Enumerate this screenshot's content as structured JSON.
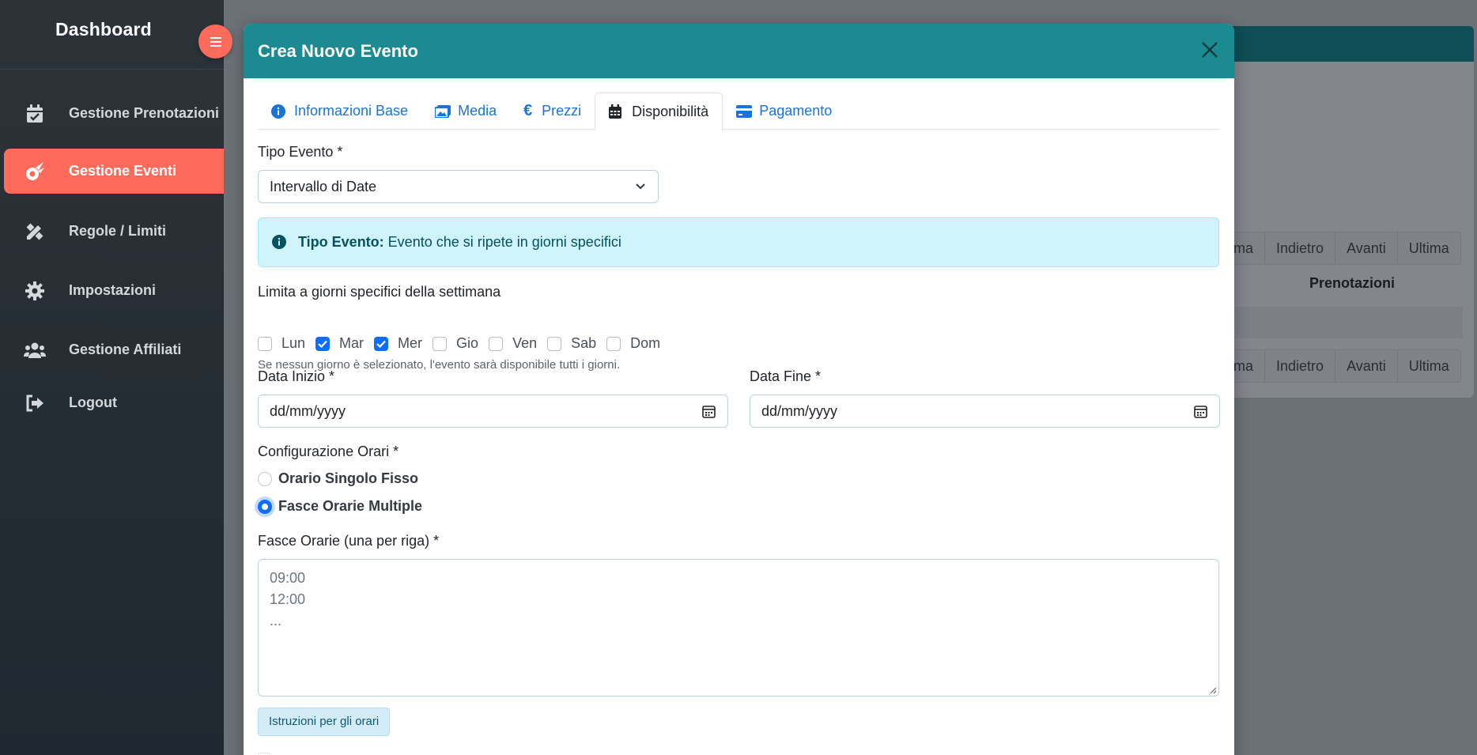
{
  "sidebar": {
    "brand": "Dashboard",
    "items": [
      {
        "label": "Gestione Prenotazioni",
        "icon": "calendar-check-icon"
      },
      {
        "label": "Gestione Eventi",
        "icon": "meteor-icon",
        "active": true
      },
      {
        "label": "Regole / Limiti",
        "icon": "ruler-pencil-icon"
      },
      {
        "label": "Impostazioni",
        "icon": "gear-icon"
      },
      {
        "label": "Gestione Affiliati",
        "icon": "users-icon"
      },
      {
        "label": "Logout",
        "icon": "logout-icon"
      }
    ]
  },
  "background": {
    "pager_top": [
      "ma",
      "Indietro",
      "Avanti",
      "Ultima"
    ],
    "pager_bottom": [
      "ma",
      "Indietro",
      "Avanti",
      "Ultima"
    ],
    "table_header": "Prenotazioni"
  },
  "modal": {
    "title": "Crea Nuovo Evento",
    "tabs": [
      {
        "label": "Informazioni Base",
        "icon": "info-circle-icon"
      },
      {
        "label": "Media",
        "icon": "images-icon"
      },
      {
        "label": "Prezzi",
        "icon": "euro-icon"
      },
      {
        "label": "Disponibilità",
        "icon": "calendar-icon",
        "active": true
      },
      {
        "label": "Pagamento",
        "icon": "credit-card-icon"
      }
    ],
    "tipo_evento": {
      "label": "Tipo Evento *",
      "value": "Intervallo di Date"
    },
    "alert": {
      "title": "Tipo Evento:",
      "text": "Evento che si ripete in giorni specifici"
    },
    "days": {
      "label": "Limita a giorni specifici della settimana",
      "items": [
        {
          "label": "Lun",
          "checked": false
        },
        {
          "label": "Mar",
          "checked": true
        },
        {
          "label": "Mer",
          "checked": true
        },
        {
          "label": "Gio",
          "checked": false
        },
        {
          "label": "Ven",
          "checked": false
        },
        {
          "label": "Sab",
          "checked": false
        },
        {
          "label": "Dom",
          "checked": false
        }
      ],
      "hint": "Se nessun giorno è selezionato, l'evento sarà disponibile tutti i giorni."
    },
    "data_inizio": {
      "label": "Data Inizio *",
      "placeholder": "dd/mm/yyyy"
    },
    "data_fine": {
      "label": "Data Fine *",
      "placeholder": "dd/mm/yyyy"
    },
    "orari": {
      "label": "Configurazione Orari *",
      "options": [
        {
          "label": "Orario Singolo Fisso",
          "selected": false
        },
        {
          "label": "Fasce Orarie Multiple",
          "selected": true
        }
      ]
    },
    "fasce": {
      "label": "Fasce Orarie (una per riga) *",
      "placeholder_lines": [
        "09:00",
        "12:00",
        "..."
      ]
    },
    "instructions_button": "Istruzioni per gli orari"
  },
  "colors": {
    "accent": "#ff6b5b",
    "modal_header": "#1c8a91",
    "link": "#1a73d9",
    "primary": "#0d6efd"
  }
}
